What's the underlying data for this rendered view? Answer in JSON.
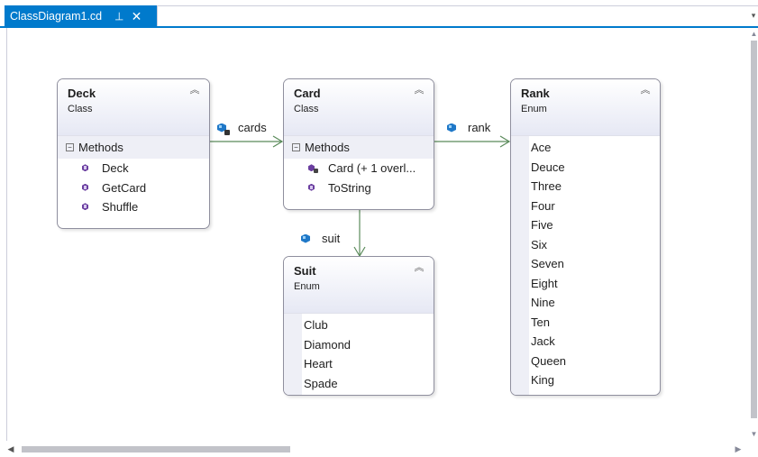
{
  "tab": {
    "title": "ClassDiagram1.cd",
    "pin_icon": "pin-icon",
    "close_icon": "close-icon"
  },
  "shapes": {
    "deck": {
      "name": "Deck",
      "kind": "Class",
      "section": "Methods",
      "members": [
        "Deck",
        "GetCard",
        "Shuffle"
      ]
    },
    "card": {
      "name": "Card",
      "kind": "Class",
      "section": "Methods",
      "members": [
        "Card (+ 1 overl...",
        "ToString"
      ]
    },
    "rank": {
      "name": "Rank",
      "kind": "Enum",
      "values": [
        "Ace",
        "Deuce",
        "Three",
        "Four",
        "Five",
        "Six",
        "Seven",
        "Eight",
        "Nine",
        "Ten",
        "Jack",
        "Queen",
        "King"
      ]
    },
    "suit": {
      "name": "Suit",
      "kind": "Enum",
      "values": [
        "Club",
        "Diamond",
        "Heart",
        "Spade"
      ]
    }
  },
  "associations": {
    "cards": "cards",
    "rank": "rank",
    "suit": "suit"
  },
  "colors": {
    "accent": "#007acc",
    "connector": "#5a8a5a",
    "header_gradient": "#e6e8f4",
    "method_icon": "#6b3fa0",
    "field_icon": "#1f78c8"
  }
}
